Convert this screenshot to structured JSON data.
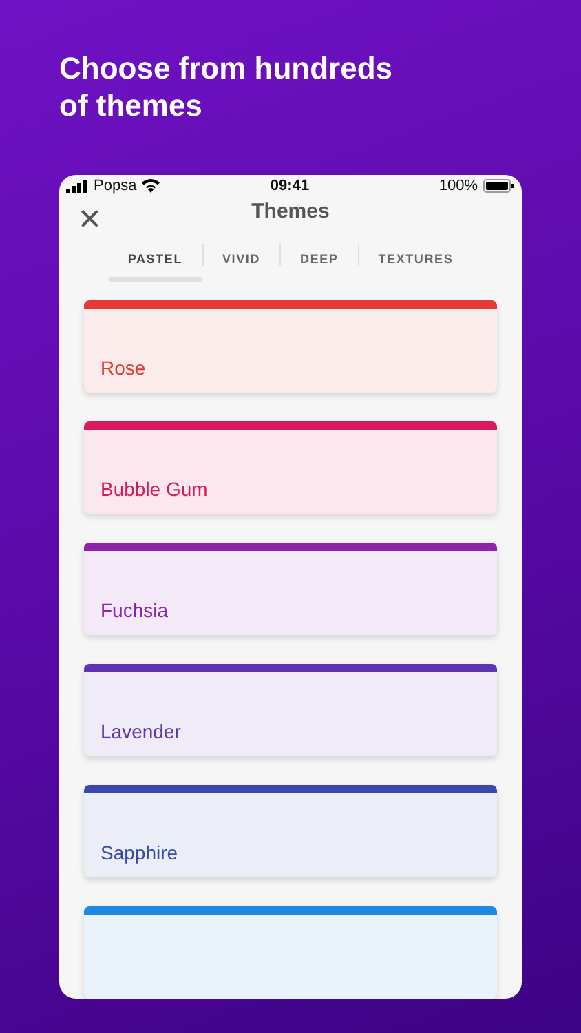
{
  "headline": "Choose from hundreds of themes",
  "status_bar": {
    "carrier": "Popsa",
    "time": "09:41",
    "battery": "100%"
  },
  "header": {
    "close": "×",
    "title": "Themes"
  },
  "tabs": [
    {
      "label": "PASTEL",
      "selected": true
    },
    {
      "label": "VIVID",
      "selected": false
    },
    {
      "label": "DEEP",
      "selected": false
    },
    {
      "label": "TEXTURES",
      "selected": false
    }
  ],
  "themes": [
    {
      "name": "Rose",
      "color": "#e53935"
    },
    {
      "name": "Bubble Gum",
      "color": "#d81b60"
    },
    {
      "name": "Fuchsia",
      "color": "#8e24aa"
    },
    {
      "name": "Lavender",
      "color": "#5e35b1"
    },
    {
      "name": "Sapphire",
      "color": "#3949ab"
    },
    {
      "color": "#1e88e5"
    }
  ]
}
